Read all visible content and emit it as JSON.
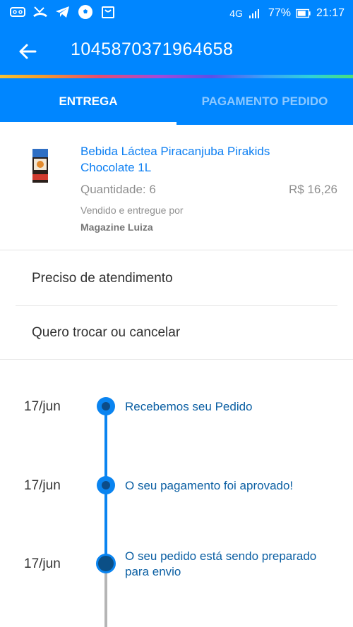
{
  "status_bar": {
    "network": "4G",
    "battery": "77%",
    "time": "21:17",
    "left_icons": [
      "voicemail-icon",
      "missed-call-icon",
      "telegram-icon",
      "soccer-ball-icon",
      "shopping-bag-icon"
    ]
  },
  "app_bar": {
    "order_number": "1045870371964658"
  },
  "tabs": [
    {
      "label": "ENTREGA",
      "active": true
    },
    {
      "label": "PAGAMENTO PEDIDO",
      "active": false
    }
  ],
  "product": {
    "name": "Bebida Láctea Piracanjuba Pirakids Chocolate 1L",
    "quantity": "Quantidade: 6",
    "price": "R$ 16,26",
    "sold_by_label": "Vendido e entregue por",
    "seller": "Magazine Luiza"
  },
  "options": [
    {
      "label": "Preciso de atendimento"
    },
    {
      "label": "Quero trocar ou cancelar"
    }
  ],
  "timeline": [
    {
      "date": "17/jun",
      "text": "Recebemos seu Pedido"
    },
    {
      "date": "17/jun",
      "text": "O seu pagamento foi aprovado!"
    },
    {
      "date": "17/jun",
      "text": "O seu pedido está sendo preparado para envio"
    }
  ],
  "colors": {
    "primary": "#0086ff",
    "link": "#0b7ef2",
    "timeline_active": "#0a84f0",
    "timeline_pending": "#b5b5b5"
  }
}
